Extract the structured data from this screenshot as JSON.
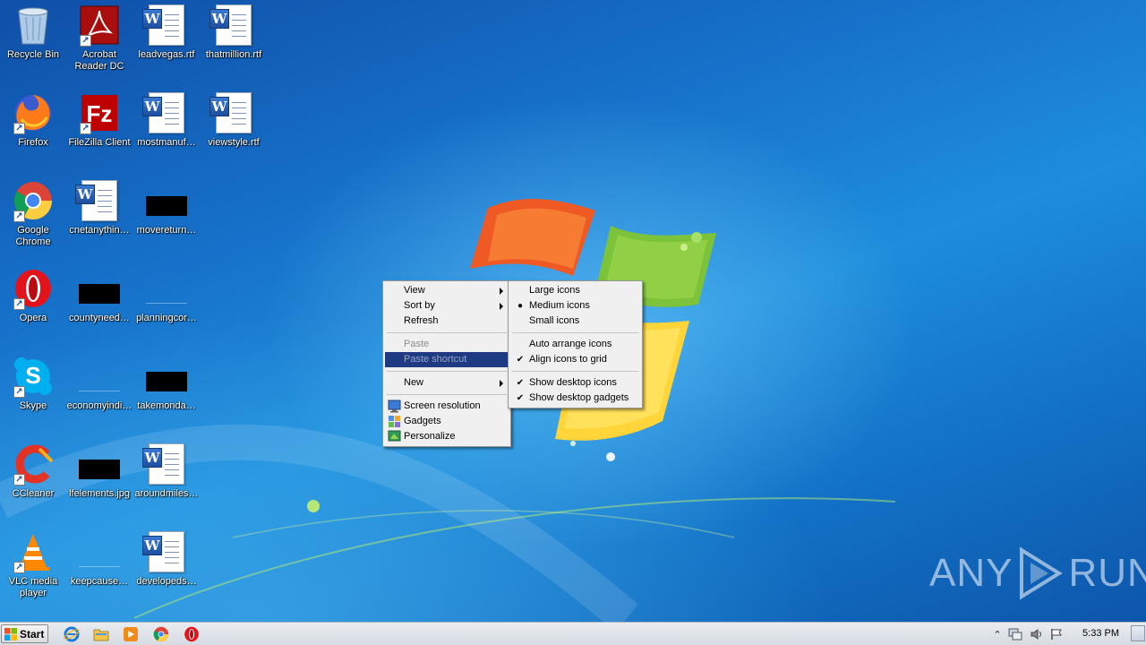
{
  "desktop": {
    "icons": [
      {
        "label": "Recycle Bin",
        "icon": "recycle-bin-icon"
      },
      {
        "label": "Acrobat Reader DC",
        "icon": "acrobat-icon"
      },
      {
        "label": "leadvegas.rtf",
        "icon": "word-document-icon"
      },
      {
        "label": "thatmillion.rtf",
        "icon": "word-document-icon"
      },
      {
        "label": "Firefox",
        "icon": "firefox-icon"
      },
      {
        "label": "FileZilla Client",
        "icon": "filezilla-icon"
      },
      {
        "label": "mostmanuf…",
        "icon": "word-document-icon"
      },
      {
        "label": "viewstyle.rtf",
        "icon": "word-document-icon"
      },
      {
        "label": "Google Chrome",
        "icon": "chrome-icon"
      },
      {
        "label": "cnetanythin…",
        "icon": "word-document-icon"
      },
      {
        "label": "movereturn…",
        "icon": "black-thumbnail-icon"
      },
      {
        "label": "Opera",
        "icon": "opera-icon"
      },
      {
        "label": "countyneed…",
        "icon": "black-thumbnail-icon"
      },
      {
        "label": "planningcor…",
        "icon": "blank-thumbnail-icon"
      },
      {
        "label": "Skype",
        "icon": "skype-icon"
      },
      {
        "label": "economyindi…",
        "icon": "blank-thumbnail-icon"
      },
      {
        "label": "takemonda…",
        "icon": "black-thumbnail-icon"
      },
      {
        "label": "CCleaner",
        "icon": "ccleaner-icon"
      },
      {
        "label": "lfelements.jpg",
        "icon": "black-thumbnail-icon"
      },
      {
        "label": "aroundmiles…",
        "icon": "word-document-icon"
      },
      {
        "label": "VLC media player",
        "icon": "vlc-icon"
      },
      {
        "label": "keepcause…",
        "icon": "blank-thumbnail-icon"
      },
      {
        "label": "developeds…",
        "icon": "word-document-icon"
      }
    ]
  },
  "context_menu": {
    "view": "View",
    "sort_by": "Sort by",
    "refresh": "Refresh",
    "paste": "Paste",
    "paste_shortcut": "Paste shortcut",
    "new": "New",
    "screen_resolution": "Screen resolution",
    "gadgets": "Gadgets",
    "personalize": "Personalize"
  },
  "view_submenu": {
    "large_icons": "Large icons",
    "medium_icons": "Medium icons",
    "small_icons": "Small icons",
    "auto_arrange": "Auto arrange icons",
    "align_to_grid": "Align icons to grid",
    "show_desktop_icons": "Show desktop icons",
    "show_desktop_gadgets": "Show desktop gadgets",
    "selected_size": "Medium icons",
    "checked": [
      "Align icons to grid",
      "Show desktop icons",
      "Show desktop gadgets"
    ]
  },
  "taskbar": {
    "start_label": "Start",
    "pinned": [
      "internet-explorer-icon",
      "windows-explorer-icon",
      "media-player-icon",
      "chrome-icon",
      "opera-icon"
    ],
    "clock": "5:33 PM"
  },
  "watermark": {
    "left": "ANY",
    "right": "RUN"
  },
  "colors": {
    "menu_highlight": "#1d3a82",
    "taskbar": "#dde1e7",
    "desktop_blue": "#1a78c8"
  }
}
